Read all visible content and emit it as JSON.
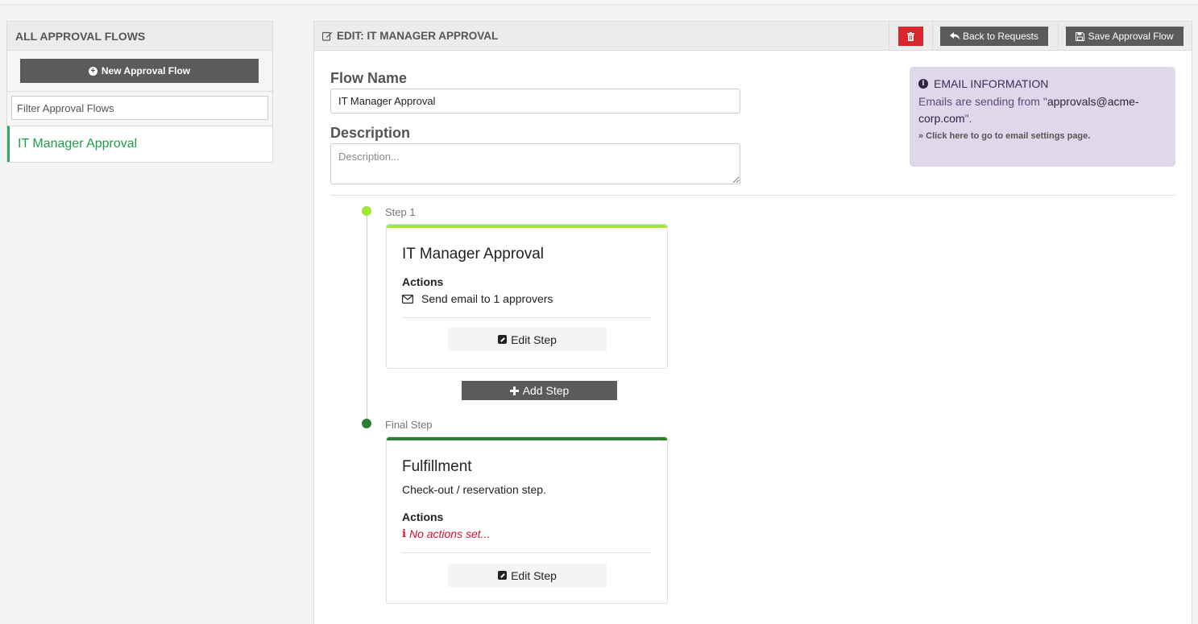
{
  "sidebar": {
    "title": "ALL APPROVAL FLOWS",
    "new_flow_label": "New Approval Flow",
    "filter_placeholder": "Filter Approval Flows",
    "items": [
      {
        "label": "IT Manager Approval"
      }
    ]
  },
  "header": {
    "title": "EDIT: IT MANAGER APPROVAL",
    "back_label": "Back to Requests",
    "save_label": "Save Approval Flow"
  },
  "form": {
    "flow_name_label": "Flow Name",
    "flow_name_value": "IT Manager Approval",
    "description_label": "Description",
    "description_placeholder": "Description..."
  },
  "email_info": {
    "title": "EMAIL INFORMATION",
    "text_prefix": "Emails are sending from \"",
    "address": "approvals@acme-corp.com",
    "text_suffix": "\".",
    "link_label": "» Click here to go to email settings page."
  },
  "steps": [
    {
      "step_label": "Step 1",
      "title": "IT Manager Approval",
      "actions_heading": "Actions",
      "action_text": "Send email to 1 approvers",
      "edit_label": "Edit Step",
      "color": "#a3e635"
    }
  ],
  "add_step_label": "Add Step",
  "final_step": {
    "step_label": "Final Step",
    "title": "Fulfillment",
    "description": "Check-out / reservation step.",
    "actions_heading": "Actions",
    "no_actions_text": "No actions set...",
    "edit_label": "Edit Step",
    "color": "#2e7d32"
  },
  "colors": {
    "accent_green": "#27ae60",
    "danger": "#d9262c",
    "dark_button": "#5b5b5b",
    "info_bg": "#dfd7ea"
  }
}
